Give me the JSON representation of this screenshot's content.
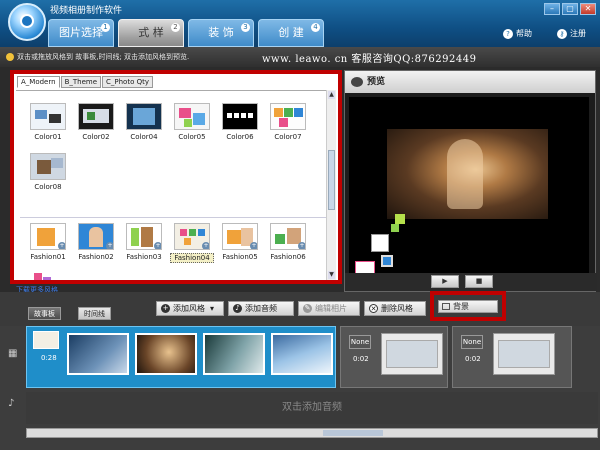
{
  "window": {
    "title": "视频相册制作软件"
  },
  "main_tabs": [
    {
      "label": "图片选择"
    },
    {
      "label": "式 样"
    },
    {
      "label": "装 饰"
    },
    {
      "label": "创 建"
    }
  ],
  "header_links": {
    "help": "帮助",
    "register": "注册"
  },
  "hint": {
    "text": "双击或拖放风格到 故事板,时间线; 双击添加风格到预览."
  },
  "watermark": "www. leawo. cn  客服咨询QQ:876292449",
  "style_panel": {
    "tabs": [
      "A_Modern",
      "B_Theme",
      "C_Photo Qty"
    ],
    "row1": [
      "Color01",
      "Color02",
      "Color04",
      "Color05",
      "Color06",
      "Color07"
    ],
    "row2": [
      "Color08"
    ],
    "row3": [
      "Fashion01",
      "Fashion02",
      "Fashion03",
      "Fashion04",
      "Fashion05",
      "Fashion06"
    ],
    "selected": "Fashion04",
    "download_link": "下载更多风格"
  },
  "preview": {
    "title": "预览",
    "play": "▶",
    "stop": "■"
  },
  "toolbar": {
    "tab_storyboard": "故事板",
    "tab_timeline": "时间线",
    "add_style": "添加风格",
    "add_music": "添加音频",
    "edit_photo": "编辑相片",
    "delete_style": "删除风格",
    "background": "背景"
  },
  "timeline": {
    "clip_time_1": "0:28",
    "transition_none": "None",
    "gap_time_1": "0:02",
    "gap_time_2": "0:02",
    "audio_hint": "双击添加音频"
  },
  "colors": {
    "accent": "#1f6fa8",
    "highlight": "#c00000",
    "storyboard": "#1f8ec9"
  }
}
